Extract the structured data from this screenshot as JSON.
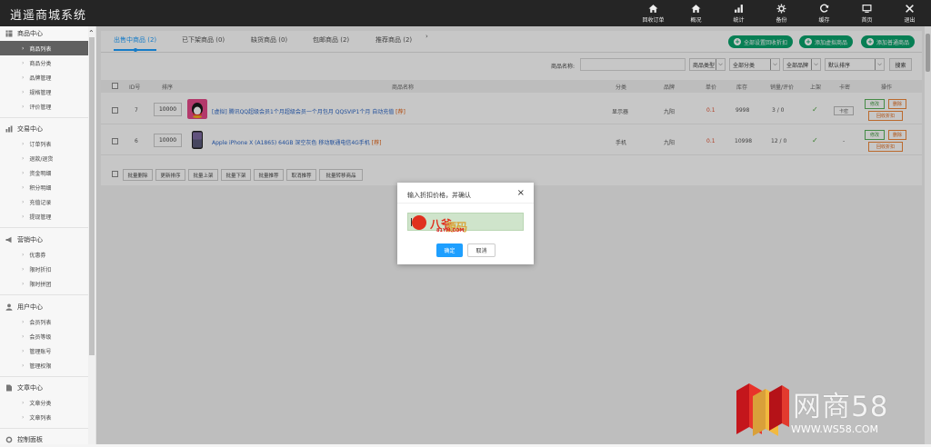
{
  "app": {
    "title": "逍遥商城系统"
  },
  "topnav": [
    {
      "label": "回收订单",
      "icon": "home-icon"
    },
    {
      "label": "概况",
      "icon": "home-icon"
    },
    {
      "label": "统计",
      "icon": "bar-chart-icon"
    },
    {
      "label": "备份",
      "icon": "gear-icon"
    },
    {
      "label": "缓存",
      "icon": "refresh-icon"
    },
    {
      "label": "首页",
      "icon": "monitor-icon"
    },
    {
      "label": "退出",
      "icon": "close-icon"
    }
  ],
  "sidebar": {
    "groups": [
      {
        "title": "商品中心",
        "icon": "grid-icon",
        "items": [
          "商品列表",
          "商品分类",
          "品牌管理",
          "规格管理",
          "评价管理"
        ],
        "active": 0
      },
      {
        "title": "交易中心",
        "icon": "bar-chart-icon",
        "items": [
          "订单列表",
          "退款/退货",
          "资金明细",
          "积分明细",
          "充值记录",
          "提现管理"
        ],
        "active": -1
      },
      {
        "title": "营销中心",
        "icon": "megaphone-icon",
        "items": [
          "优惠券",
          "限时折扣",
          "限时拼团"
        ],
        "active": -1
      },
      {
        "title": "用户中心",
        "icon": "user-icon",
        "items": [
          "会员列表",
          "会员等级",
          "管理账号",
          "管理权限"
        ],
        "active": -1
      },
      {
        "title": "文章中心",
        "icon": "document-icon",
        "items": [
          "文章分类",
          "文章列表"
        ],
        "active": -1
      },
      {
        "title": "控制面板",
        "icon": "gear-icon",
        "items": [],
        "active": -1
      }
    ]
  },
  "tabs": [
    {
      "label": "出售中商品",
      "count": "(2)"
    },
    {
      "label": "已下架商品",
      "count": "(0)"
    },
    {
      "label": "缺货商品",
      "count": "(0)"
    },
    {
      "label": "包邮商品",
      "count": "(2)"
    },
    {
      "label": "推荐商品",
      "count": "(2)"
    }
  ],
  "actions": {
    "recycle_all": "全部设置回收折扣",
    "add_virtual": "添加虚拟商品",
    "add_normal": "添加普通商品"
  },
  "filters": {
    "name_label": "商品名称:",
    "name_value": "",
    "type_select": "商品类型",
    "category_select": "全部分类",
    "brand_select": "全部品牌",
    "sort_select": "默认排序",
    "search_label": "搜索"
  },
  "table": {
    "headers": {
      "id": "ID号",
      "sort": "排序",
      "name": "商品名称",
      "category": "分类",
      "brand": "品牌",
      "price": "单价",
      "stock": "库存",
      "sales": "销量/评价",
      "onsale": "上架",
      "recommend": "卡密",
      "ops": "操作"
    },
    "rows": [
      {
        "id": "7",
        "sort": "10000",
        "name": "[虚拟] 腾讯QQ超级会员1个月超级会员一个月包月 QQSVIP1个月 自动充值",
        "mark": "[荐]",
        "category": "显示器",
        "brand": "九阳",
        "price": "0.1",
        "stock": "9998",
        "sales": "3 / 0",
        "card": "卡密",
        "op_edit": "修改",
        "op_delete": "删除",
        "op_recycle": "回收折扣"
      },
      {
        "id": "6",
        "sort": "10000",
        "name": "Apple iPhone X (A1865) 64GB 深空灰色 移动联通电信4G手机",
        "mark": "[荐]",
        "category": "手机",
        "brand": "九阳",
        "price": "0.1",
        "stock": "10998",
        "sales": "12 / 0",
        "card": "-",
        "op_edit": "修改",
        "op_delete": "删除",
        "op_recycle": "回收折扣"
      }
    ]
  },
  "bulk": [
    "批量删除",
    "更新排序",
    "批量上架",
    "批量下架",
    "批量推荐",
    "取消推荐",
    "批量转移商品"
  ],
  "modal": {
    "title": "输入折扣价格，并确认",
    "input_value": "",
    "ok": "确定",
    "cancel": "取消",
    "watermark_cn": "八爷",
    "watermark_cn2": "源码",
    "watermark_url": "81YM.COM"
  },
  "watermark": {
    "text": "网商58",
    "url": "WWW.WS58.COM"
  }
}
